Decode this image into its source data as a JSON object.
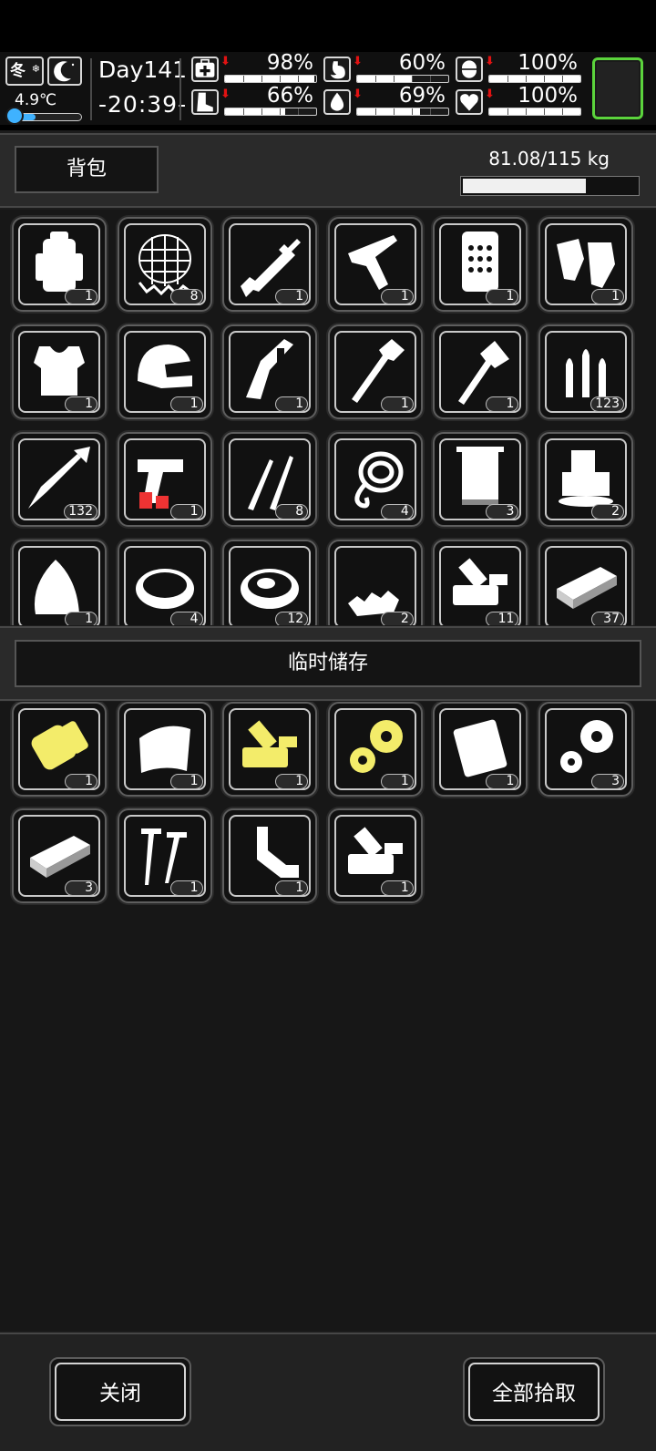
{
  "status": {
    "season": "冬",
    "temperature": "4.9℃",
    "temperature_level": 0.38,
    "day": "Day141",
    "clock": "-20:39-",
    "stats": [
      {
        "icon": "medkit-icon",
        "value": "98%",
        "level": 0.98
      },
      {
        "icon": "stomach-icon",
        "value": "60%",
        "level": 0.6
      },
      {
        "icon": "pill-icon",
        "value": "100%",
        "level": 1.0
      },
      {
        "icon": "boot-icon",
        "value": "66%",
        "level": 0.66
      },
      {
        "icon": "water-drop-icon",
        "value": "69%",
        "level": 0.69
      },
      {
        "icon": "heart-icon",
        "value": "100%",
        "level": 1.0
      }
    ]
  },
  "backpack": {
    "title": "背包",
    "weight": "81.08/115 kg",
    "weight_level": 0.705,
    "items": [
      {
        "icon": "backpack-icon",
        "qty": "1"
      },
      {
        "icon": "net-icon",
        "qty": "8"
      },
      {
        "icon": "rifle-icon",
        "qty": "1"
      },
      {
        "icon": "crossbow-icon",
        "qty": "1"
      },
      {
        "icon": "shield-plate-icon",
        "qty": "1"
      },
      {
        "icon": "gloves-icon",
        "qty": "1"
      },
      {
        "icon": "body-armor-icon",
        "qty": "1"
      },
      {
        "icon": "helmet-icon",
        "qty": "1"
      },
      {
        "icon": "multitool-icon",
        "qty": "1"
      },
      {
        "icon": "shovel-icon",
        "qty": "1"
      },
      {
        "icon": "axe-icon",
        "qty": "1"
      },
      {
        "icon": "bullets-icon",
        "qty": "123"
      },
      {
        "icon": "arrow-icon",
        "qty": "132"
      },
      {
        "icon": "flare-gun-icon",
        "qty": "1"
      },
      {
        "icon": "lockpick-icon",
        "qty": "8"
      },
      {
        "icon": "rope-icon",
        "qty": "4"
      },
      {
        "icon": "towel-icon",
        "qty": "3"
      },
      {
        "icon": "ice-icon",
        "qty": "2"
      },
      {
        "icon": "meat-icon",
        "qty": "1"
      },
      {
        "icon": "bowl-icon",
        "qty": "4"
      },
      {
        "icon": "stew-icon",
        "qty": "12"
      },
      {
        "icon": "scrap-icon",
        "qty": "2"
      },
      {
        "icon": "machine-parts-icon",
        "qty": "11"
      },
      {
        "icon": "metal-bar-icon",
        "qty": "37"
      }
    ]
  },
  "storage": {
    "title": "临时储存",
    "items": [
      {
        "icon": "yellow-bolt-icon",
        "qty": "1",
        "color": "#f3ec6a"
      },
      {
        "icon": "cloth-icon",
        "qty": "1",
        "color": "#ffffff"
      },
      {
        "icon": "yellow-machine-parts-icon",
        "qty": "1",
        "color": "#f3ec6a"
      },
      {
        "icon": "yellow-gears-icon",
        "qty": "1",
        "color": "#f3ec6a"
      },
      {
        "icon": "metal-plate-icon",
        "qty": "1",
        "color": "#ffffff"
      },
      {
        "icon": "gears-icon",
        "qty": "3",
        "color": "#ffffff"
      },
      {
        "icon": "metal-bar-icon",
        "qty": "3",
        "color": "#ffffff"
      },
      {
        "icon": "screws-icon",
        "qty": "1",
        "color": "#ffffff"
      },
      {
        "icon": "pipe-icon",
        "qty": "1",
        "color": "#ffffff"
      },
      {
        "icon": "machine-parts-icon",
        "qty": "1",
        "color": "#ffffff"
      }
    ]
  },
  "buttons": {
    "close": "关闭",
    "take_all": "全部拾取"
  }
}
